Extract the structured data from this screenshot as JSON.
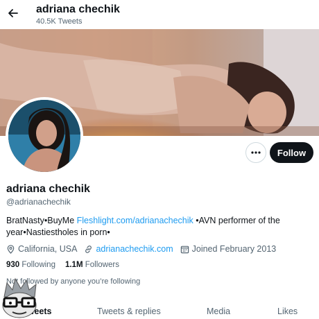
{
  "header": {
    "back_icon": "arrow-left-icon",
    "title": "adriana chechik",
    "tweet_count": "40.5K Tweets"
  },
  "profile": {
    "display_name": "adriana chechik",
    "handle": "@adrianachechik",
    "more_icon": "more-dots-icon",
    "follow_label": "Follow",
    "bio": {
      "before_link": "BratNasty•BuyMe ",
      "link": "Fleshlight.com/adrianachechik",
      "after_link": " •AVN performer of the year•Nastiestholes in porn•"
    },
    "meta": {
      "location_icon": "location-pin-icon",
      "location": "California, USA",
      "website_icon": "link-icon",
      "website": "adrianachechik.com",
      "joined_icon": "calendar-icon",
      "joined": "Joined February 2013"
    },
    "stats": {
      "following_count": "930",
      "following_label": "Following",
      "followers_count": "1.1M",
      "followers_label": "Followers"
    },
    "followed_by": "Not followed by anyone you’re following"
  },
  "tabs": [
    {
      "label": "Tweets",
      "active": true
    },
    {
      "label": "Tweets & replies",
      "active": false
    },
    {
      "label": "Media",
      "active": false
    },
    {
      "label": "Likes",
      "active": false
    }
  ],
  "colors": {
    "accent": "#1d9bf0",
    "text": "#0f1419",
    "secondary": "#536471",
    "button_dark": "#0f1419"
  }
}
